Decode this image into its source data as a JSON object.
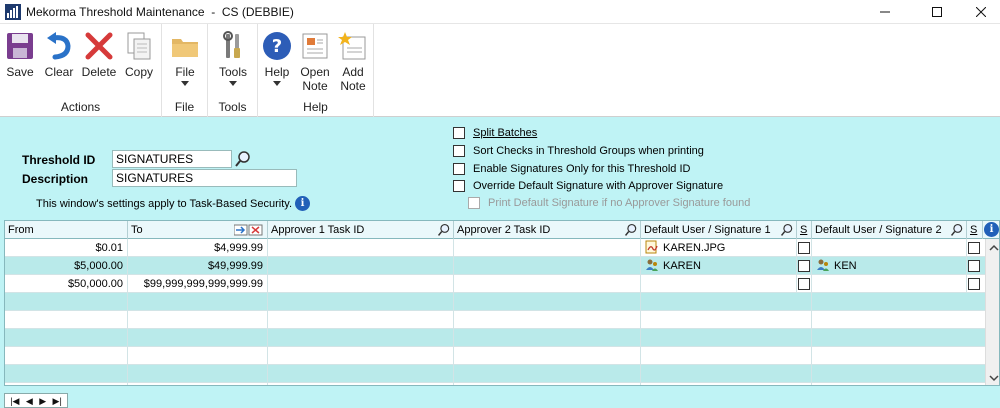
{
  "window": {
    "title": "Mekorma Threshold Maintenance  -  CS (DEBBIE)"
  },
  "ribbon": {
    "actions": {
      "label": "Actions",
      "save": "Save",
      "clear": "Clear",
      "delete": "Delete",
      "copy": "Copy"
    },
    "file": {
      "label": "File",
      "button": "File"
    },
    "tools": {
      "label": "Tools",
      "button": "Tools"
    },
    "help": {
      "label": "Help",
      "help": "Help",
      "open_note_1": "Open",
      "open_note_2": "Note",
      "add_note_1": "Add",
      "add_note_2": "Note"
    }
  },
  "form": {
    "threshold_id_label": "Threshold ID",
    "threshold_id_value": "SIGNATURES",
    "description_label": "Description",
    "description_value": "SIGNATURES",
    "security_note": "This window's settings apply to Task-Based Security."
  },
  "options": {
    "split_batches": "Split Batches",
    "sort_checks": "Sort Checks in Threshold Groups when printing",
    "enable_signatures": "Enable Signatures Only for this Threshold ID",
    "override_signature": "Override Default Signature with Approver Signature",
    "print_default": "Print Default Signature if no Approver Signature found"
  },
  "grid": {
    "headers": {
      "from": "From",
      "to": "To",
      "approver1": "Approver 1 Task ID",
      "approver2": "Approver 2 Task ID",
      "user1": "Default User / Signature 1",
      "s1": "S",
      "user2": "Default User / Signature 2",
      "s2": "S"
    },
    "rows": [
      {
        "from": "$0.01",
        "to": "$4,999.99",
        "approver1": "",
        "approver2": "",
        "user1": "KAREN.JPG",
        "user1_icon": "signature-file-icon",
        "user2": "",
        "user2_icon": ""
      },
      {
        "from": "$5,000.00",
        "to": "$49,999.99",
        "approver1": "",
        "approver2": "",
        "user1": "KAREN",
        "user1_icon": "user-icon",
        "user2": "KEN",
        "user2_icon": "user-icon"
      },
      {
        "from": "$50,000.00",
        "to": "$99,999,999,999,999.99",
        "approver1": "",
        "approver2": "",
        "user1": "",
        "user1_icon": "",
        "user2": "",
        "user2_icon": ""
      }
    ]
  },
  "colors": {
    "window_bg": "#bff3f5",
    "row_alt": "#b9eaea",
    "accent_blue": "#2160b8"
  }
}
